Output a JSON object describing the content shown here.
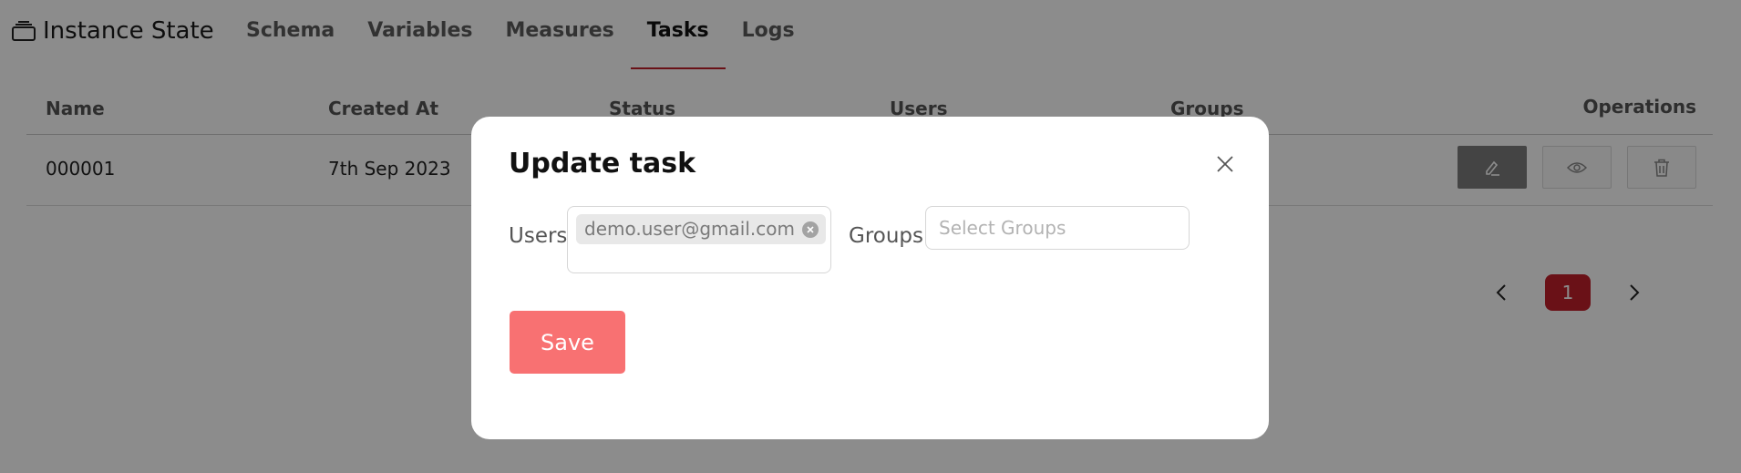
{
  "brand": {
    "title": "Instance State"
  },
  "tabs": [
    {
      "label": "Schema",
      "active": false
    },
    {
      "label": "Variables",
      "active": false
    },
    {
      "label": "Measures",
      "active": false
    },
    {
      "label": "Tasks",
      "active": true
    },
    {
      "label": "Logs",
      "active": false
    }
  ],
  "table": {
    "headers": {
      "name": "Name",
      "created_at": "Created At",
      "status": "Status",
      "users": "Users",
      "groups": "Groups",
      "operations": "Operations"
    },
    "rows": [
      {
        "name": "000001",
        "created_at": "7th Sep 2023",
        "status": "",
        "users": "",
        "groups": ""
      }
    ],
    "operations_icons": [
      "edit-icon",
      "eye-icon",
      "trash-icon"
    ]
  },
  "pagination": {
    "current_page": "1"
  },
  "modal": {
    "title": "Update task",
    "users_label": "Users",
    "groups_label": "Groups",
    "selected_users": [
      "demo.user@gmail.com"
    ],
    "groups_placeholder": "Select Groups",
    "save_label": "Save"
  },
  "colors": {
    "accent": "#c1202b",
    "save_button": "#f87172",
    "overlay": "rgba(0,0,0,0.45)"
  }
}
